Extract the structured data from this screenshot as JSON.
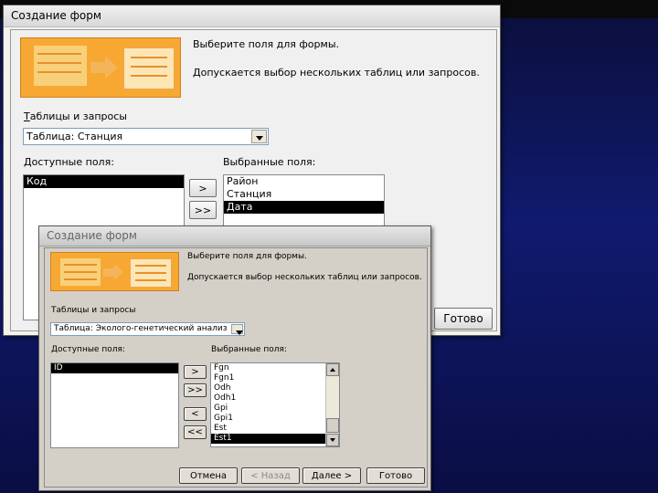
{
  "win1": {
    "title": "Создание форм",
    "intro_line1": "Выберите поля для формы.",
    "intro_line2": "Допускается выбор нескольких таблиц или запросов.",
    "tables_label": "Таблицы и запросы",
    "table_value": "Таблица: Станция",
    "available_label": "Доступные поля:",
    "selected_label": "Выбранные поля:",
    "available_fields": [
      "Код"
    ],
    "selected_fields": [
      "Район",
      "Станция",
      "Дата"
    ],
    "add_one_label": ">",
    "add_all_label": ">>",
    "finish_label": "Готово"
  },
  "win2": {
    "title": "Создание форм",
    "intro_line1": "Выберите поля для формы.",
    "intro_line2": "Допускается выбор нескольких таблиц или запросов.",
    "tables_label": "Таблицы и запросы",
    "table_value": "Таблица: Эколого-генетический анализ",
    "available_label": "Доступные поля:",
    "selected_label": "Выбранные поля:",
    "available_fields": [
      "ID"
    ],
    "selected_fields": [
      "Fgn",
      "Fgn1",
      "Odh",
      "Odh1",
      "Gpi",
      "Gpi1",
      "Est",
      "Est1"
    ],
    "add_one_label": ">",
    "add_all_label": ">>",
    "remove_one_label": "<",
    "remove_all_label": "<<",
    "cancel_label": "Отмена",
    "back_label": "< Назад",
    "next_label": "Далее >",
    "finish_label": "Готово"
  },
  "colors": {
    "illustration_orange": "#f7a832",
    "selection_black": "#000000",
    "background_blue": "#101a6e"
  }
}
